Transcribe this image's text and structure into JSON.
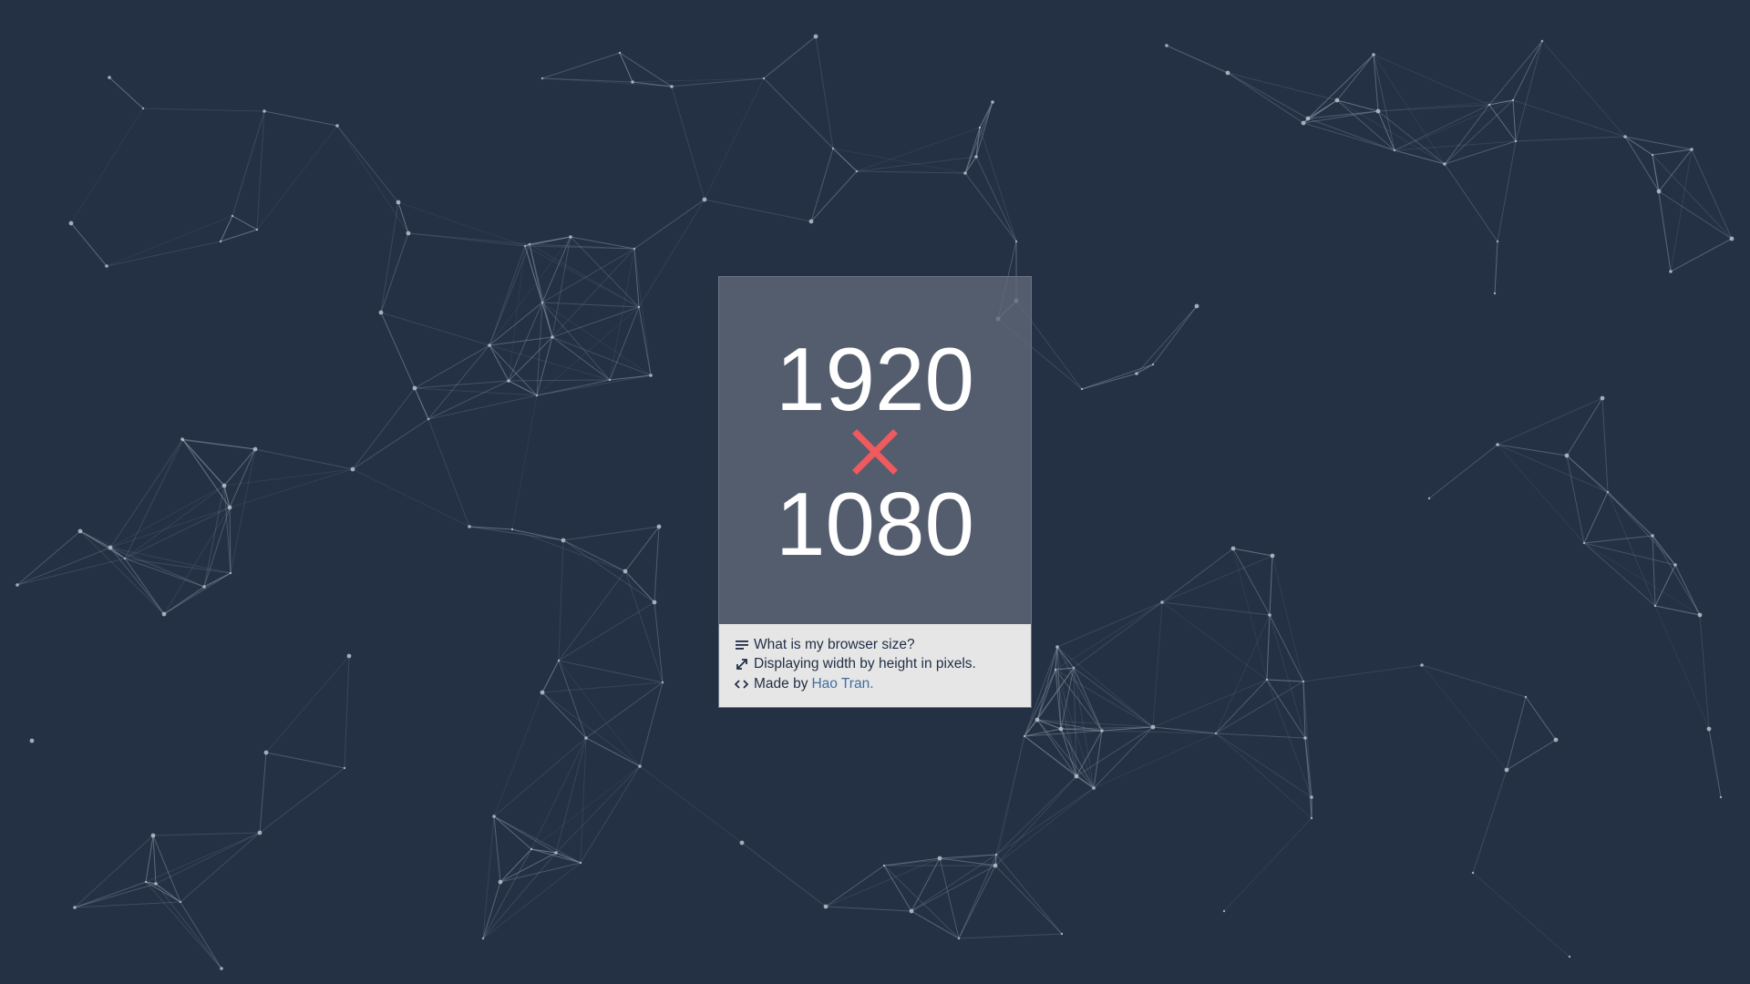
{
  "background_color": "#243044",
  "display": {
    "width": "1920",
    "height": "1080",
    "times_color": "#f05a5f"
  },
  "info": {
    "line1": "What is my browser size?",
    "line2": "Displaying width by height in pixels.",
    "line3_prefix": "Made by",
    "line3_link": "Hao Tran",
    "line3_suffix": ".",
    "icons": [
      "text-lines-icon",
      "resize-arrow-icon",
      "code-brackets-icon"
    ]
  }
}
